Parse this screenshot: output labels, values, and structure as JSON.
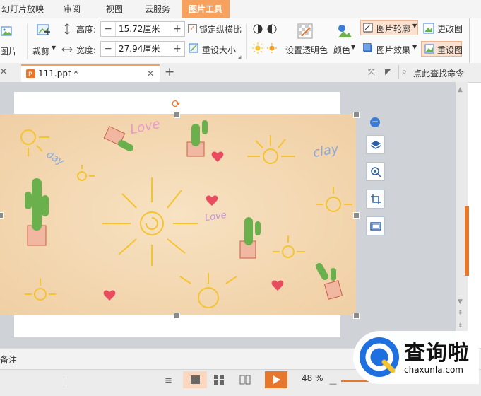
{
  "menu": {
    "tabs": [
      {
        "label": "幻灯片放映"
      },
      {
        "label": "审阅"
      },
      {
        "label": "视图"
      },
      {
        "label": "云服务"
      },
      {
        "label": "图片工具"
      }
    ]
  },
  "ribbon": {
    "insert_picture_label": "图片",
    "crop_label": "裁剪",
    "height_label": "高度:",
    "height_value": "15.72厘米",
    "width_label": "宽度:",
    "width_value": "27.94厘米",
    "lock_ratio_label": "锁定纵横比",
    "reset_size_label": "重设大小",
    "set_transparent_label": "设置透明色",
    "color_label": "颜色",
    "picture_outline_label": "图片轮廓",
    "picture_effect_label": "图片效果",
    "change_picture_label": "更改图",
    "reset_picture_label": "重设图"
  },
  "tabbar": {
    "doc_name": "111.ppt *",
    "search_label": "点此查找命令"
  },
  "picture": {
    "text_love_1": "Love",
    "text_day": "day",
    "text_love_2": "Love",
    "text_clay": "clay"
  },
  "notes": {
    "label": "备注"
  },
  "statusbar": {
    "zoom": "48 %"
  },
  "watermark": {
    "brand": "查询啦",
    "url": "chaxunla.com"
  },
  "colors": {
    "accent": "#f6a15e",
    "play_button": "#e8772e",
    "sun": "#f4c430",
    "cactus": "#6ab04c",
    "heart": "#e84c5e"
  }
}
